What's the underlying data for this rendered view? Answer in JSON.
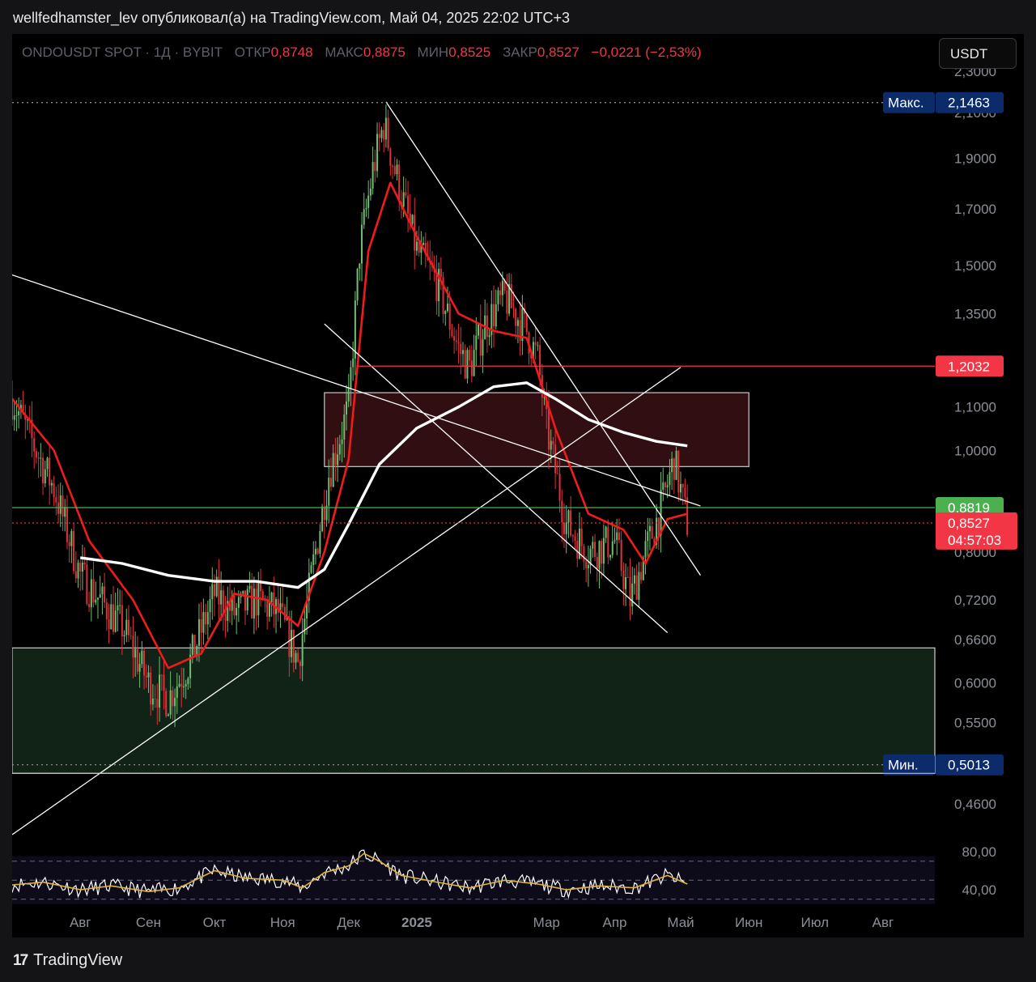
{
  "caption": "wellfedhamster_lev опубликовал(а) на TradingView.com, Май 04, 2025 22:02 UTC+3",
  "legend": {
    "symbol": "ONDOUSDT SPOT · 1Д · BYBIT",
    "open_label": "ОТКР",
    "open": "0,8748",
    "high_label": "МАКС",
    "high": "0,8875",
    "low_label": "МИН",
    "low": "0,8525",
    "close_label": "ЗАКР",
    "close": "0,8527",
    "change": "−0,0221 (−2,53%)"
  },
  "currency_button": "USDT",
  "footer": {
    "logo_text": "TradingView",
    "logo_icon": "tradingview-logo-icon"
  },
  "colors": {
    "up": "#6fbf73",
    "down": "#e0303a",
    "ema_fast": "#f01b1b",
    "ema_slow": "#ffffff",
    "zone_resist": "#3a1014",
    "zone_support": "#13261a",
    "level_green": "#4caf50",
    "level_red": "#f23645",
    "label_blue": "#0c2b6b"
  },
  "chart_data": {
    "type": "candlestick",
    "title": "ONDOUSDT SPOT · 1Д · BYBIT",
    "scale": "log",
    "y_ticks": [
      "2,3000",
      "2,1000",
      "1,9000",
      "1,7000",
      "1,5000",
      "1,3500",
      "1,1000",
      "1,0000",
      "0,8000",
      "0,7200",
      "0,6600",
      "0,6000",
      "0,5500",
      "0,4600"
    ],
    "y_tick_values": [
      2.3,
      2.1,
      1.9,
      1.7,
      1.5,
      1.35,
      1.1,
      1.0,
      0.8,
      0.72,
      0.66,
      0.6,
      0.55,
      0.46
    ],
    "x_labels": [
      "Авг",
      "Сен",
      "Окт",
      "Ноя",
      "Дек",
      "2025",
      "Мар",
      "Апр",
      "Май",
      "Июн",
      "Июл",
      "Авг"
    ],
    "x_label_dates": [
      "2024-08-01",
      "2024-09-01",
      "2024-10-01",
      "2024-11-01",
      "2024-12-01",
      "2025-01-01",
      "2025-03-01",
      "2025-04-01",
      "2025-05-01",
      "2025-06-01",
      "2025-07-01",
      "2025-08-01"
    ],
    "price_labels": [
      {
        "name": "max",
        "text": "Макс.",
        "value": "2,1463",
        "level": 2.1463
      },
      {
        "name": "resistance",
        "value": "1,2032",
        "level": 1.2032
      },
      {
        "name": "support",
        "value": "0,8819",
        "level": 0.8819
      },
      {
        "name": "last",
        "value": "0,8527",
        "level": 0.8527,
        "countdown": "04:57:03"
      },
      {
        "name": "min",
        "text": "Мин.",
        "value": "0,5013",
        "level": 0.5013
      }
    ],
    "zones": [
      {
        "name": "resistance-zone",
        "from": "2024-11-20",
        "to": "2025-06-01",
        "low": 0.965,
        "high": 1.135
      },
      {
        "name": "support-zone",
        "from": "2024-07-01",
        "to": "2025-09-01",
        "low": 0.492,
        "high": 0.648
      }
    ],
    "price_path": [
      [
        "2024-07-01",
        1.12
      ],
      [
        "2024-07-10",
        1.02
      ],
      [
        "2024-07-20",
        0.92
      ],
      [
        "2024-08-01",
        0.76
      ],
      [
        "2024-08-10",
        0.72
      ],
      [
        "2024-08-20",
        0.68
      ],
      [
        "2024-09-01",
        0.6
      ],
      [
        "2024-09-10",
        0.58
      ],
      [
        "2024-09-20",
        0.63
      ],
      [
        "2024-10-01",
        0.73
      ],
      [
        "2024-10-10",
        0.7
      ],
      [
        "2024-10-20",
        0.72
      ],
      [
        "2024-10-30",
        0.7
      ],
      [
        "2024-11-08",
        0.63
      ],
      [
        "2024-11-15",
        0.78
      ],
      [
        "2024-11-22",
        0.95
      ],
      [
        "2024-12-01",
        1.1
      ],
      [
        "2024-12-06",
        1.55
      ],
      [
        "2024-12-12",
        1.85
      ],
      [
        "2024-12-17",
        2.05
      ],
      [
        "2024-12-22",
        1.85
      ],
      [
        "2025-01-01",
        1.55
      ],
      [
        "2025-01-10",
        1.45
      ],
      [
        "2025-01-20",
        1.25
      ],
      [
        "2025-01-25",
        1.2
      ],
      [
        "2025-02-01",
        1.32
      ],
      [
        "2025-02-10",
        1.4
      ],
      [
        "2025-02-20",
        1.3
      ],
      [
        "2025-02-25",
        1.22
      ],
      [
        "2025-03-01",
        1.05
      ],
      [
        "2025-03-10",
        0.85
      ],
      [
        "2025-03-20",
        0.8
      ],
      [
        "2025-04-01",
        0.82
      ],
      [
        "2025-04-08",
        0.72
      ],
      [
        "2025-04-15",
        0.8
      ],
      [
        "2025-04-22",
        0.88
      ],
      [
        "2025-04-28",
        0.98
      ],
      [
        "2025-05-04",
        0.853
      ]
    ],
    "ema_fast": [
      [
        "2024-07-01",
        1.12
      ],
      [
        "2024-07-20",
        1.0
      ],
      [
        "2024-08-05",
        0.82
      ],
      [
        "2024-08-25",
        0.72
      ],
      [
        "2024-09-10",
        0.62
      ],
      [
        "2024-09-25",
        0.64
      ],
      [
        "2024-10-10",
        0.73
      ],
      [
        "2024-10-25",
        0.72
      ],
      [
        "2024-11-08",
        0.68
      ],
      [
        "2024-11-20",
        0.8
      ],
      [
        "2024-12-01",
        0.98
      ],
      [
        "2024-12-10",
        1.55
      ],
      [
        "2024-12-20",
        1.8
      ],
      [
        "2025-01-01",
        1.6
      ],
      [
        "2025-01-20",
        1.35
      ],
      [
        "2025-02-05",
        1.3
      ],
      [
        "2025-02-20",
        1.28
      ],
      [
        "2025-03-05",
        1.05
      ],
      [
        "2025-03-20",
        0.87
      ],
      [
        "2025-04-05",
        0.84
      ],
      [
        "2025-04-15",
        0.78
      ],
      [
        "2025-04-25",
        0.86
      ],
      [
        "2025-05-04",
        0.87
      ]
    ],
    "ema_slow": [
      [
        "2024-08-01",
        0.79
      ],
      [
        "2024-08-20",
        0.78
      ],
      [
        "2024-09-10",
        0.76
      ],
      [
        "2024-10-01",
        0.75
      ],
      [
        "2024-10-20",
        0.75
      ],
      [
        "2024-11-08",
        0.74
      ],
      [
        "2024-11-20",
        0.77
      ],
      [
        "2024-12-01",
        0.85
      ],
      [
        "2024-12-15",
        0.97
      ],
      [
        "2025-01-01",
        1.05
      ],
      [
        "2025-01-20",
        1.1
      ],
      [
        "2025-02-05",
        1.15
      ],
      [
        "2025-02-20",
        1.16
      ],
      [
        "2025-03-05",
        1.12
      ],
      [
        "2025-03-20",
        1.07
      ],
      [
        "2025-04-05",
        1.04
      ],
      [
        "2025-04-20",
        1.02
      ],
      [
        "2025-05-04",
        1.01
      ]
    ],
    "trendlines": [
      {
        "name": "desc-long",
        "p1": [
          "2024-07-01",
          1.47
        ],
        "p2": [
          "2025-05-10",
          0.885
        ]
      },
      {
        "name": "asc-long",
        "p1": [
          "2024-07-01",
          0.43
        ],
        "p2": [
          "2025-05-01",
          1.2
        ]
      },
      {
        "name": "desc-steep",
        "p1": [
          "2024-12-18",
          2.15
        ],
        "p2": [
          "2025-05-10",
          0.76
        ]
      },
      {
        "name": "channel-low",
        "p1": [
          "2024-11-20",
          1.32
        ],
        "p2": [
          "2025-04-25",
          0.67
        ]
      }
    ],
    "rsi": {
      "ticks": [
        "80,00",
        "40,00"
      ],
      "tick_values": [
        80,
        40
      ],
      "levels": [
        70,
        50,
        30
      ],
      "values": [
        [
          "2024-07-01",
          45
        ],
        [
          "2024-07-15",
          48
        ],
        [
          "2024-08-01",
          40
        ],
        [
          "2024-08-15",
          44
        ],
        [
          "2024-09-01",
          38
        ],
        [
          "2024-09-15",
          42
        ],
        [
          "2024-10-01",
          60
        ],
        [
          "2024-10-15",
          52
        ],
        [
          "2024-11-01",
          50
        ],
        [
          "2024-11-10",
          42
        ],
        [
          "2024-11-20",
          58
        ],
        [
          "2024-12-01",
          65
        ],
        [
          "2024-12-08",
          78
        ],
        [
          "2024-12-15",
          70
        ],
        [
          "2024-12-25",
          55
        ],
        [
          "2025-01-10",
          48
        ],
        [
          "2025-01-25",
          42
        ],
        [
          "2025-02-10",
          50
        ],
        [
          "2025-02-25",
          46
        ],
        [
          "2025-03-10",
          40
        ],
        [
          "2025-03-25",
          44
        ],
        [
          "2025-04-10",
          42
        ],
        [
          "2025-04-25",
          55
        ],
        [
          "2025-05-04",
          46
        ]
      ]
    }
  }
}
